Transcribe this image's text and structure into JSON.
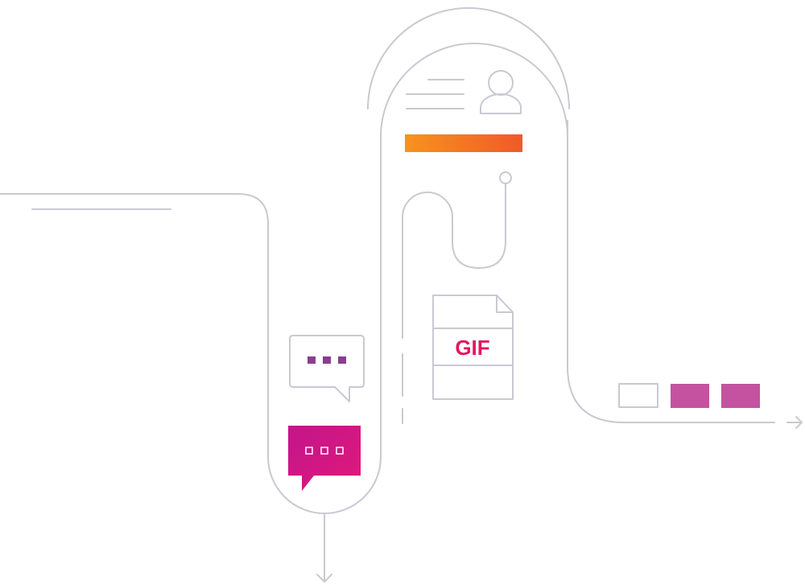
{
  "illustration": {
    "file_label": "GIF",
    "colors": {
      "line": "#c9c9d3",
      "gradient_start": "#f7931e",
      "gradient_end": "#f05a28",
      "purple_dots": "#8b3d8f",
      "magenta_bubble_start": "#c2168b",
      "magenta_bubble_end": "#e0187a",
      "magenta_square": "#c452a0",
      "gif_text": "#e3175f"
    },
    "icons": {
      "profile": "user-profile-icon",
      "chat_outline": "chat-bubble-outline-icon",
      "chat_filled": "chat-bubble-filled-icon",
      "file": "gif-file-icon",
      "arrow_down": "arrow-down-icon",
      "arrow_right": "arrow-right-icon"
    }
  }
}
